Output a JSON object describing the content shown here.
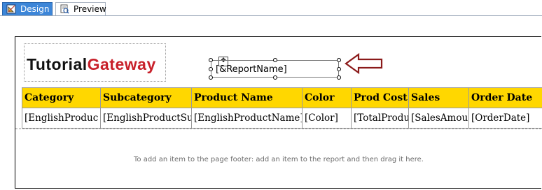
{
  "tabs": [
    {
      "label": "Design",
      "icon": "design-icon",
      "active": true
    },
    {
      "label": "Preview",
      "icon": "preview-icon",
      "active": false
    }
  ],
  "report": {
    "logo": {
      "part1": "Tutorial",
      "part2": "Gateway",
      "color1": "#111111",
      "color2": "#c8202a"
    },
    "report_name_field": "[&ReportName]",
    "annotation": "arrow-icon",
    "table": {
      "headers": [
        "Category",
        "Subcategory",
        "Product Name",
        "Color",
        "Prod Cost",
        "Sales",
        "Order Date"
      ],
      "row": [
        "[EnglishProduc",
        "[EnglishProductSu",
        "[EnglishProductName]",
        "[Color]",
        "[TotalProdu",
        "[SalesAmou",
        "[OrderDate]"
      ],
      "header_color": "#ffd700"
    },
    "footer_message": "To add an item to the page footer: add an item to the report and then drag it here."
  }
}
